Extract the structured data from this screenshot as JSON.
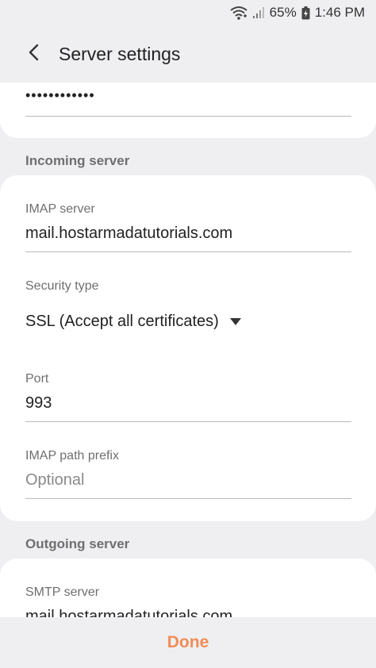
{
  "status_bar": {
    "battery_percent": "65%",
    "time": "1:46 PM"
  },
  "header": {
    "title": "Server settings"
  },
  "account": {
    "password_value": "••••••••••••"
  },
  "incoming": {
    "section_title": "Incoming server",
    "imap_server_label": "IMAP server",
    "imap_server_value": "mail.hostarmadatutorials.com",
    "security_type_label": "Security type",
    "security_type_value": "SSL (Accept all certificates)",
    "port_label": "Port",
    "port_value": "993",
    "path_prefix_label": "IMAP path prefix",
    "path_prefix_placeholder": "Optional"
  },
  "outgoing": {
    "section_title": "Outgoing server",
    "smtp_server_label": "SMTP server",
    "smtp_server_value": "mail.hostarmadatutorials.com"
  },
  "bottom_bar": {
    "done_label": "Done"
  },
  "colors": {
    "accent": "#f08c57",
    "background": "#efeff1",
    "card": "#ffffff"
  }
}
